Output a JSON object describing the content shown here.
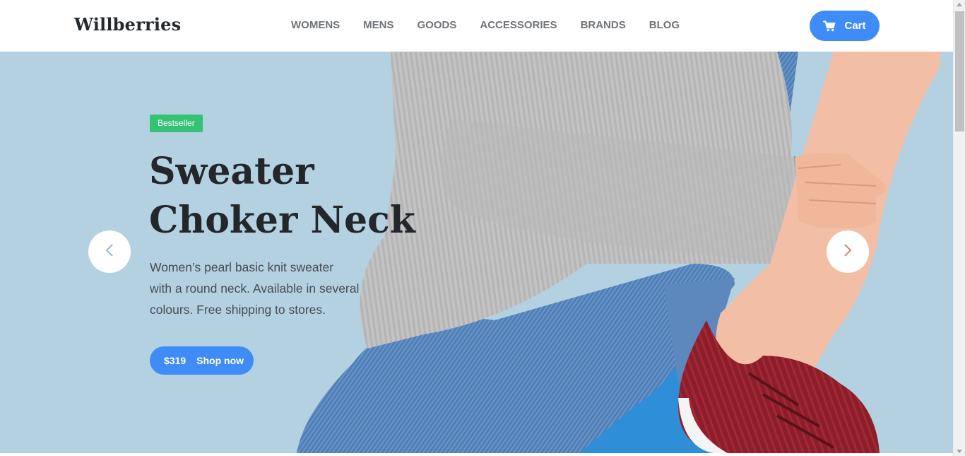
{
  "header": {
    "logo": "Willberries",
    "nav": [
      {
        "label": "WOMENS"
      },
      {
        "label": "MENS"
      },
      {
        "label": "GOODS"
      },
      {
        "label": "ACCESSORIES"
      },
      {
        "label": "BRANDS"
      },
      {
        "label": "BLOG"
      }
    ],
    "cart_label": "Cart",
    "cart_icon": "cart-icon"
  },
  "hero": {
    "badge": "Bestseller",
    "title_line1": "Sweater",
    "title_line2": "Choker Neck",
    "description_line1": "Women’s pearl basic knit sweater",
    "description_line2": "with a round neck. Available in several",
    "description_line3": "colours. Free shipping to stores.",
    "price": "$319",
    "shop_label": "Shop now",
    "prev_icon": "chevron-left-icon",
    "next_icon": "chevron-right-icon"
  },
  "colors": {
    "accent": "#3f8cf7",
    "badge": "#36c275",
    "hero_bg": "#b3d1e0",
    "text_dark": "#23262b",
    "nav_text": "#6f7378"
  }
}
